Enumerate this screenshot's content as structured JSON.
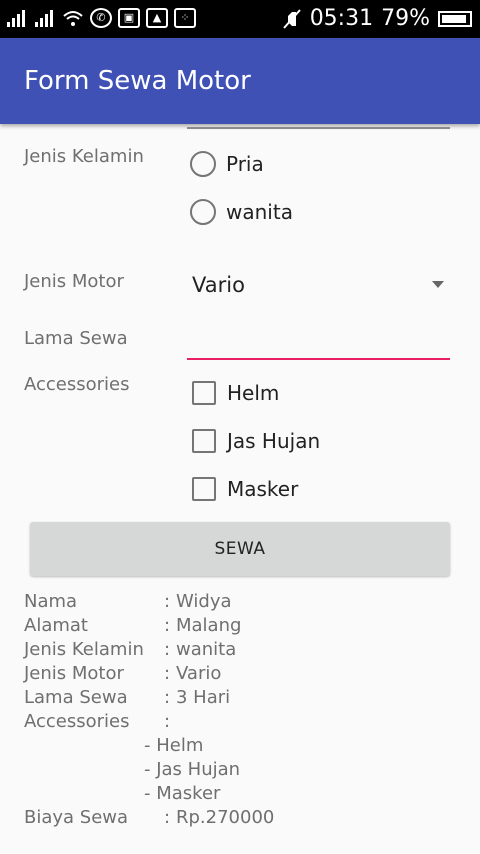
{
  "status_bar": {
    "time": "05:31",
    "battery": "79%"
  },
  "app_bar": {
    "title": "Form Sewa Motor"
  },
  "form": {
    "gender": {
      "label": "Jenis Kelamin",
      "options": [
        "Pria",
        "wanita"
      ]
    },
    "motor": {
      "label": "Jenis Motor",
      "selected": "Vario"
    },
    "duration": {
      "label": "Lama Sewa",
      "value": ""
    },
    "accessories": {
      "label": "Accessories",
      "options": [
        "Helm",
        "Jas Hujan",
        "Masker"
      ]
    },
    "submit_label": "SEWA"
  },
  "result": {
    "rows": [
      {
        "key": "Nama",
        "sep": ":",
        "value": "Widya"
      },
      {
        "key": "Alamat",
        "sep": ":",
        "value": "Malang"
      },
      {
        "key": "Jenis Kelamin",
        "sep": ":",
        "value": "wanita"
      },
      {
        "key": "Jenis Motor",
        "sep": ":",
        "value": "Vario"
      },
      {
        "key": "Lama Sewa",
        "sep": ":",
        "value": "3 Hari"
      },
      {
        "key": "Accessories",
        "sep": ":",
        "value": ""
      }
    ],
    "accessories": [
      "- Helm",
      "- Jas Hujan",
      "- Masker"
    ],
    "cost": {
      "key": "Biaya Sewa",
      "sep": ":",
      "value": "Rp.270000"
    }
  }
}
